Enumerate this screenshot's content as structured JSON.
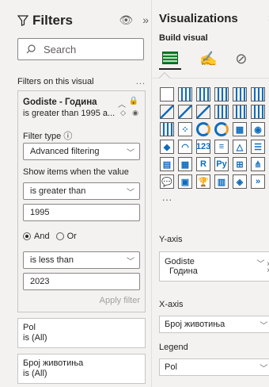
{
  "filters": {
    "title": "Filters",
    "search_placeholder": "Search",
    "section_label": "Filters on this visual",
    "section_more": "...",
    "active_card": {
      "title": "Godiste - Година",
      "summary": "is greater than 1995 a...",
      "filter_type_label": "Filter type ⓘ",
      "filter_type_value": "Advanced filtering",
      "show_items_label": "Show items when the value",
      "condition1_operator": "is greater than",
      "condition1_value": "1995",
      "logic_and": "And",
      "logic_or": "Or",
      "condition2_operator": "is less than",
      "condition2_value": "2023",
      "apply_label": "Apply filter"
    },
    "cards": [
      {
        "title": "Pol",
        "summary": "is (All)"
      },
      {
        "title": "Број животиња",
        "summary": "is (All)"
      }
    ]
  },
  "viz": {
    "title": "Visualizations",
    "build_label": "Build visual",
    "yaxis_label": "Y-axis",
    "yaxis_field": "Godiste",
    "yaxis_sub": "Година",
    "xaxis_label": "X-axis",
    "xaxis_field": "Број животиња",
    "legend_label": "Legend",
    "legend_field": "Pol",
    "icons": [
      {
        "name": "table-icon",
        "type": "box",
        "glyph": ""
      },
      {
        "name": "stacked-bar-icon",
        "type": "bar",
        "glyph": ""
      },
      {
        "name": "clustered-bar-icon",
        "type": "bar",
        "glyph": ""
      },
      {
        "name": "column-chart-icon",
        "type": "bar",
        "glyph": ""
      },
      {
        "name": "stacked-column-icon",
        "type": "bar",
        "glyph": ""
      },
      {
        "name": "clustered-column-icon",
        "type": "bar",
        "glyph": ""
      },
      {
        "name": "line-chart-icon",
        "type": "line",
        "glyph": ""
      },
      {
        "name": "area-chart-icon",
        "type": "line",
        "glyph": ""
      },
      {
        "name": "stacked-area-icon",
        "type": "line",
        "glyph": ""
      },
      {
        "name": "ribbon-icon",
        "type": "bar",
        "glyph": ""
      },
      {
        "name": "waterfall-icon",
        "type": "bar",
        "glyph": ""
      },
      {
        "name": "combo-icon",
        "type": "bar",
        "glyph": ""
      },
      {
        "name": "funnel-icon",
        "type": "bar",
        "glyph": ""
      },
      {
        "name": "scatter-icon",
        "type": "box",
        "glyph": "⁘"
      },
      {
        "name": "pie-chart-icon",
        "type": "pie",
        "glyph": ""
      },
      {
        "name": "donut-chart-icon",
        "type": "pie",
        "glyph": ""
      },
      {
        "name": "treemap-icon",
        "type": "box",
        "glyph": "▦"
      },
      {
        "name": "map-icon",
        "type": "box",
        "glyph": "◉"
      },
      {
        "name": "filled-map-icon",
        "type": "box",
        "glyph": "◆"
      },
      {
        "name": "gauge-icon",
        "type": "box",
        "glyph": "◠"
      },
      {
        "name": "card-icon",
        "type": "box",
        "glyph": "123"
      },
      {
        "name": "multirow-card-icon",
        "type": "box",
        "glyph": "≡"
      },
      {
        "name": "kpi-icon",
        "type": "box",
        "glyph": "△"
      },
      {
        "name": "slicer-icon",
        "type": "box",
        "glyph": "☰"
      },
      {
        "name": "matrix-icon",
        "type": "box",
        "glyph": "▤"
      },
      {
        "name": "grid-table-icon",
        "type": "box",
        "glyph": "▦"
      },
      {
        "name": "r-visual-icon",
        "type": "box",
        "glyph": "R"
      },
      {
        "name": "python-visual-icon",
        "type": "box",
        "glyph": "Py"
      },
      {
        "name": "key-influencers-icon",
        "type": "box",
        "glyph": "⊞"
      },
      {
        "name": "decomposition-tree-icon",
        "type": "box",
        "glyph": "⋔"
      },
      {
        "name": "qa-icon",
        "type": "box",
        "glyph": "💬"
      },
      {
        "name": "smart-narrative-icon",
        "type": "box",
        "glyph": "▣"
      },
      {
        "name": "goals-icon",
        "type": "box",
        "glyph": "🏆"
      },
      {
        "name": "paginated-report-icon",
        "type": "box",
        "glyph": "▥"
      },
      {
        "name": "power-apps-icon",
        "type": "box",
        "glyph": "◈"
      },
      {
        "name": "power-automate-icon",
        "type": "box",
        "glyph": "»"
      },
      {
        "name": "more-visuals-icon",
        "type": "more",
        "glyph": "···"
      }
    ]
  }
}
